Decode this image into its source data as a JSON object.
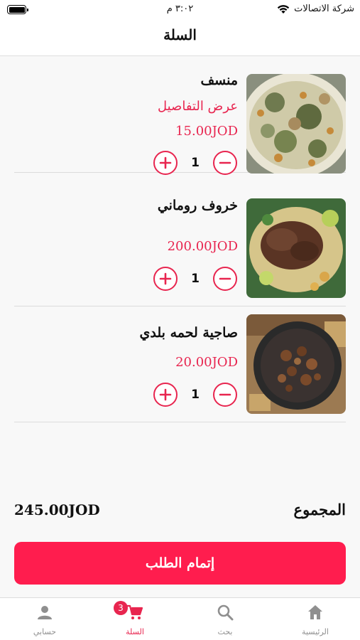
{
  "status_bar": {
    "time": "٣:٠٢ م",
    "carrier": "شركة الاتصالات"
  },
  "header": {
    "title": "السلة"
  },
  "cart": {
    "items": [
      {
        "name": "منسف",
        "details_label": "عرض التفاصيل",
        "price": "15.00JOD",
        "quantity": "1",
        "image_icon": "mansaf-dish-photo"
      },
      {
        "name": "خروف روماني",
        "price": "200.00JOD",
        "quantity": "1",
        "image_icon": "roast-lamb-photo"
      },
      {
        "name": "صاجية لحمه بلدي",
        "price": "20.00JOD",
        "quantity": "1",
        "image_icon": "meat-pan-photo"
      }
    ]
  },
  "summary": {
    "total_label": "المجموع",
    "total_value": "245.00JOD"
  },
  "checkout": {
    "label": "إتمام الطلب"
  },
  "tab_bar": {
    "badge_count": "3",
    "tabs": [
      {
        "label": "حسابي",
        "icon": "person-icon"
      },
      {
        "label": "السلة",
        "icon": "cart-icon",
        "active": true
      },
      {
        "label": "بحث",
        "icon": "search-icon"
      },
      {
        "label": "الرئيسية",
        "icon": "home-icon"
      }
    ]
  },
  "colors": {
    "accent": "#e8254f",
    "checkout_button": "#ff1d4e"
  }
}
